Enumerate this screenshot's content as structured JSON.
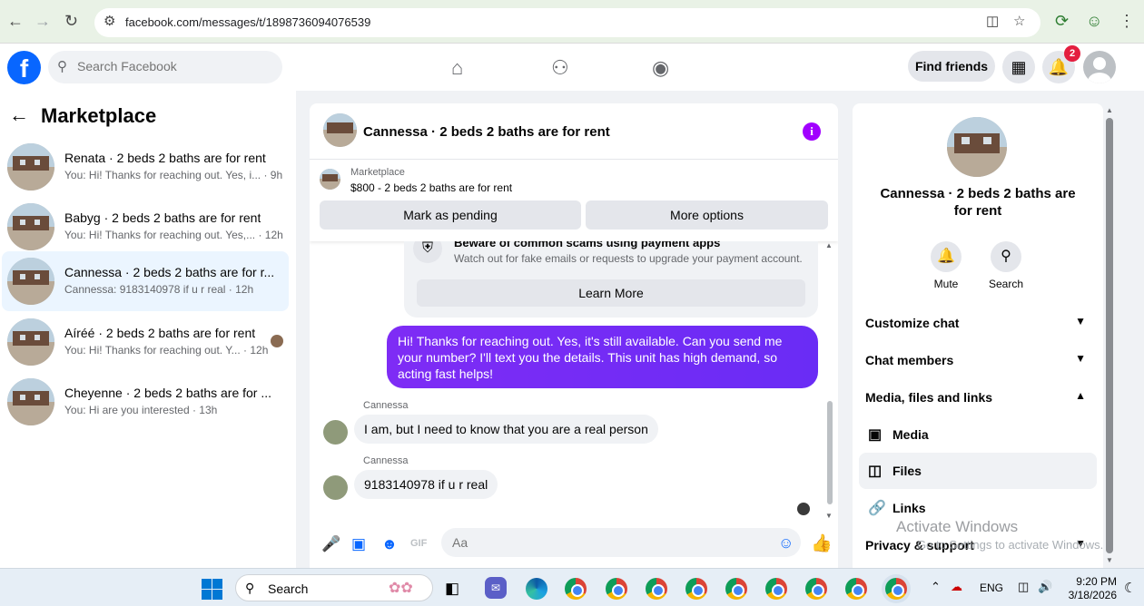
{
  "browser": {
    "url": "facebook.com/messages/t/1898736094076539"
  },
  "header": {
    "logo": "f",
    "search_placeholder": "Search Facebook",
    "find_friends": "Find friends",
    "notif_count": "2"
  },
  "left": {
    "title": "Marketplace",
    "conversations": [
      {
        "name": "Renata · 2 beds 2 baths are for rent",
        "preview": "You: Hi! Thanks for reaching out. Yes, i... · 9h"
      },
      {
        "name": "Babyg · 2 beds 2 baths are for rent",
        "preview": "You: Hi! Thanks for reaching out. Yes,... · 12h"
      },
      {
        "name": "Cannessa · 2 beds 2 baths are for r...",
        "preview": "Cannessa: 9183140978 if u r real · 12h"
      },
      {
        "name": "Aíréé · 2 beds 2 baths are for rent",
        "preview": "You: Hi! Thanks for reaching out. Y... · 12h"
      },
      {
        "name": "Cheyenne · 2 beds 2 baths are for ...",
        "preview": "You: Hi are you interested · 13h"
      }
    ]
  },
  "chat": {
    "title": "Cannessa · 2 beds 2 baths are for rent",
    "listing_label": "Marketplace",
    "listing_price": "$800 - 2 beds 2 baths are for rent",
    "mark_pending": "Mark as pending",
    "more_options": "More options",
    "scam_title": "Beware of common scams using payment apps",
    "scam_sub": "Watch out for fake emails or requests to upgrade your payment account.",
    "learn_more": "Learn More",
    "outgoing": "Hi! Thanks for reaching out. Yes, it's still available. Can you send me your number? I'll text you the details. This unit has high demand, so acting fast helps!",
    "incoming": [
      {
        "sender": "Cannessa",
        "text": "I am, but I need to know that you are a real person"
      },
      {
        "sender": "Cannessa",
        "text": "9183140978 if u r real"
      }
    ],
    "composer_placeholder": "Aa"
  },
  "right": {
    "name": "Cannessa · 2 beds 2 baths are for rent",
    "mute": "Mute",
    "search": "Search",
    "customize": "Customize chat",
    "members": "Chat members",
    "media_files": "Media, files and links",
    "media": "Media",
    "files": "Files",
    "links": "Links",
    "privacy": "Privacy & support"
  },
  "watermark": {
    "title": "Activate Windows",
    "sub": "Go to Settings to activate Windows."
  },
  "taskbar": {
    "search": "Search",
    "lang": "ENG",
    "time": "9:20 PM",
    "date": "3/18/2026"
  },
  "colors": {
    "fb_blue": "#0866ff",
    "messenger_purple": "#7e2cf5",
    "info_purple": "#a100ff",
    "notif_red": "#e41e3f",
    "selected_bg": "#ebf5ff"
  }
}
